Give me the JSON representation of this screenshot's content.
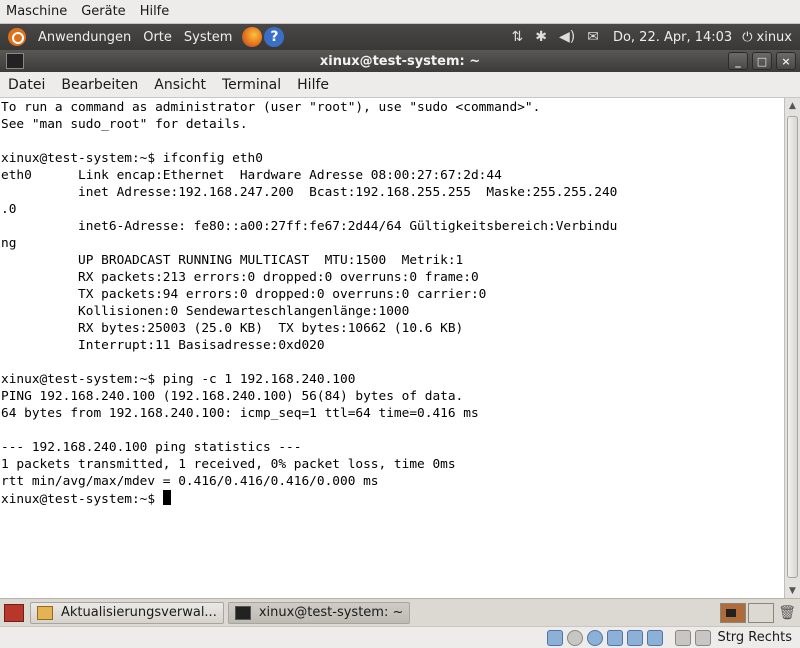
{
  "vbox_menu": [
    "Maschine",
    "Geräte",
    "Hilfe"
  ],
  "top_panel": {
    "menus": [
      "Anwendungen",
      "Orte",
      "System"
    ],
    "clock": "Do, 22. Apr, 14:03",
    "user": "xinux"
  },
  "window": {
    "title": "xinux@test-system: ~",
    "buttons": [
      "_",
      "□",
      "×"
    ]
  },
  "term_menu": [
    "Datei",
    "Bearbeiten",
    "Ansicht",
    "Terminal",
    "Hilfe"
  ],
  "terminal_lines": [
    "To run a command as administrator (user \"root\"), use \"sudo <command>\".",
    "See \"man sudo_root\" for details.",
    "",
    "xinux@test-system:~$ ifconfig eth0",
    "eth0      Link encap:Ethernet  Hardware Adresse 08:00:27:67:2d:44",
    "          inet Adresse:192.168.247.200  Bcast:192.168.255.255  Maske:255.255.240",
    ".0",
    "          inet6-Adresse: fe80::a00:27ff:fe67:2d44/64 Gültigkeitsbereich:Verbindu",
    "ng",
    "          UP BROADCAST RUNNING MULTICAST  MTU:1500  Metrik:1",
    "          RX packets:213 errors:0 dropped:0 overruns:0 frame:0",
    "          TX packets:94 errors:0 dropped:0 overruns:0 carrier:0",
    "          Kollisionen:0 Sendewarteschlangenlänge:1000",
    "          RX bytes:25003 (25.0 KB)  TX bytes:10662 (10.6 KB)",
    "          Interrupt:11 Basisadresse:0xd020",
    "",
    "xinux@test-system:~$ ping -c 1 192.168.240.100",
    "PING 192.168.240.100 (192.168.240.100) 56(84) bytes of data.",
    "64 bytes from 192.168.240.100: icmp_seq=1 ttl=64 time=0.416 ms",
    "",
    "--- 192.168.240.100 ping statistics ---",
    "1 packets transmitted, 1 received, 0% packet loss, time 0ms",
    "rtt min/avg/max/mdev = 0.416/0.416/0.416/0.000 ms"
  ],
  "prompt": "xinux@test-system:~$ ",
  "taskbar": {
    "tasks": [
      "Aktualisierungsverwal...",
      "xinux@test-system: ~"
    ]
  },
  "vbox_status": {
    "host_key": "Strg Rechts"
  },
  "colors": {
    "panel_dark": "#3a3836",
    "chrome_light": "#edeceb",
    "terminal_bg": "#ffffff",
    "terminal_fg": "#000000"
  }
}
